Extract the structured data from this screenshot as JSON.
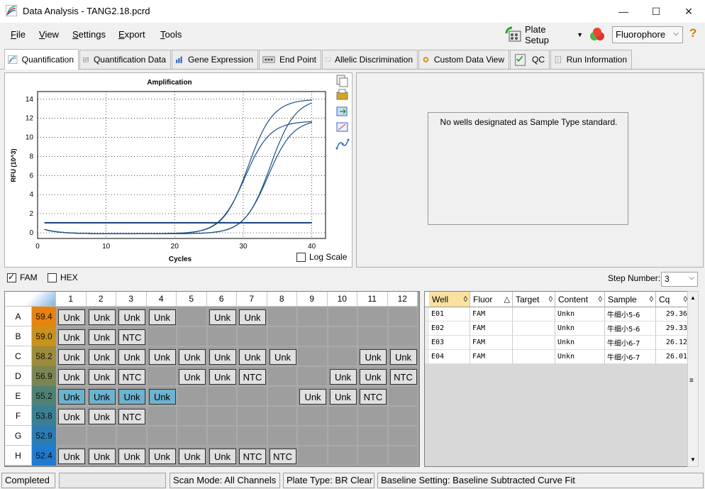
{
  "window": {
    "title": "Data Analysis - TANG2.18.pcrd",
    "minimize": "—",
    "maximize": "☐",
    "close": "✕"
  },
  "menu": [
    "File",
    "View",
    "Settings",
    "Export",
    "Tools"
  ],
  "toolbar": {
    "plate_setup": "Plate Setup",
    "fluorophore": "Fluorophore",
    "help": "?"
  },
  "tabs": [
    "Quantification",
    "Quantification Data",
    "Gene Expression",
    "End Point",
    "Allelic Discrimination",
    "Custom Data View",
    "QC",
    "Run Information"
  ],
  "chart_data": {
    "type": "line",
    "title": "Amplification",
    "xlabel": "Cycles",
    "ylabel": "RFU (10^3)",
    "xlim": [
      0,
      42
    ],
    "ylim": [
      -0.6,
      14.8
    ],
    "xticks": [
      0,
      10,
      20,
      30,
      40
    ],
    "yticks": [
      0,
      2,
      4,
      6,
      8,
      10,
      12,
      14
    ],
    "grid": true,
    "threshold": 1.05,
    "series": [
      {
        "well": "E01",
        "cq": 29.36,
        "plateau": 14.2
      },
      {
        "well": "E02",
        "cq": 29.33,
        "plateau": 12.0
      },
      {
        "well": "E03",
        "cq": 26.12,
        "plateau": 14.1
      },
      {
        "well": "E04",
        "cq": 26.01,
        "plateau": 11.8
      }
    ]
  },
  "log_scale_label": "Log Scale",
  "standard_message": "No wells designated as Sample Type standard.",
  "fluors": {
    "fam": "FAM",
    "hex": "HEX"
  },
  "step": {
    "label": "Step Number:",
    "value": "3"
  },
  "plate": {
    "columns": [
      "1",
      "2",
      "3",
      "4",
      "5",
      "6",
      "7",
      "8",
      "9",
      "10",
      "11",
      "12"
    ],
    "rows": [
      {
        "label": "A",
        "temp": "59.4",
        "color": "#e8820e",
        "wells": [
          "Unk",
          "Unk",
          "Unk",
          "Unk",
          "",
          "Unk",
          "Unk",
          "",
          "",
          "",
          "",
          ""
        ]
      },
      {
        "label": "B",
        "temp": "59.0",
        "color": "#c9921c",
        "wells": [
          "Unk",
          "Unk",
          "NTC",
          "",
          "",
          "",
          "",
          "",
          "",
          "",
          "",
          ""
        ]
      },
      {
        "label": "C",
        "temp": "58.2",
        "color": "#9d8c3a",
        "wells": [
          "Unk",
          "Unk",
          "Unk",
          "Unk",
          "Unk",
          "Unk",
          "Unk",
          "Unk",
          "",
          "",
          "Unk",
          "Unk"
        ]
      },
      {
        "label": "D",
        "temp": "56.9",
        "color": "#7a8552",
        "wells": [
          "Unk",
          "Unk",
          "NTC",
          "",
          "Unk",
          "Unk",
          "NTC",
          "",
          "",
          "Unk",
          "Unk",
          "NTC"
        ]
      },
      {
        "label": "E",
        "temp": "55.2",
        "color": "#4f8274",
        "wells": [
          "Unk",
          "Unk",
          "Unk",
          "Unk",
          "",
          "",
          "",
          "",
          "Unk",
          "Unk",
          "NTC",
          ""
        ]
      },
      {
        "label": "F",
        "temp": "53.8",
        "color": "#3a7f92",
        "wells": [
          "Unk",
          "Unk",
          "NTC",
          "",
          "",
          "",
          "",
          "",
          "",
          "",
          "",
          ""
        ]
      },
      {
        "label": "G",
        "temp": "52.9",
        "color": "#2b7cb1",
        "wells": [
          "",
          "",
          "",
          "",
          "",
          "",
          "",
          "",
          "",
          "",
          "",
          ""
        ]
      },
      {
        "label": "H",
        "temp": "52.4",
        "color": "#1f7ad1",
        "wells": [
          "Unk",
          "Unk",
          "Unk",
          "Unk",
          "Unk",
          "Unk",
          "NTC",
          "NTC",
          "",
          "",
          "",
          ""
        ]
      }
    ]
  },
  "table": {
    "columns": [
      "Well",
      "Fluor",
      "Target",
      "Content",
      "Sample",
      "Cq"
    ],
    "rows": [
      [
        "E01",
        "FAM",
        "",
        "Unkn",
        "牛细小5-6",
        "29.36"
      ],
      [
        "E02",
        "FAM",
        "",
        "Unkn",
        "牛细小5-6",
        "29.33"
      ],
      [
        "E03",
        "FAM",
        "",
        "Unkn",
        "牛细小6-7",
        "26.12"
      ],
      [
        "E04",
        "FAM",
        "",
        "Unkn",
        "牛细小6-7",
        "26.01"
      ]
    ]
  },
  "status": {
    "completed": "Completed",
    "scan_mode": "Scan Mode: All Channels",
    "plate_type": "Plate Type: BR Clear",
    "baseline": "Baseline Setting: Baseline Subtracted Curve Fit"
  }
}
